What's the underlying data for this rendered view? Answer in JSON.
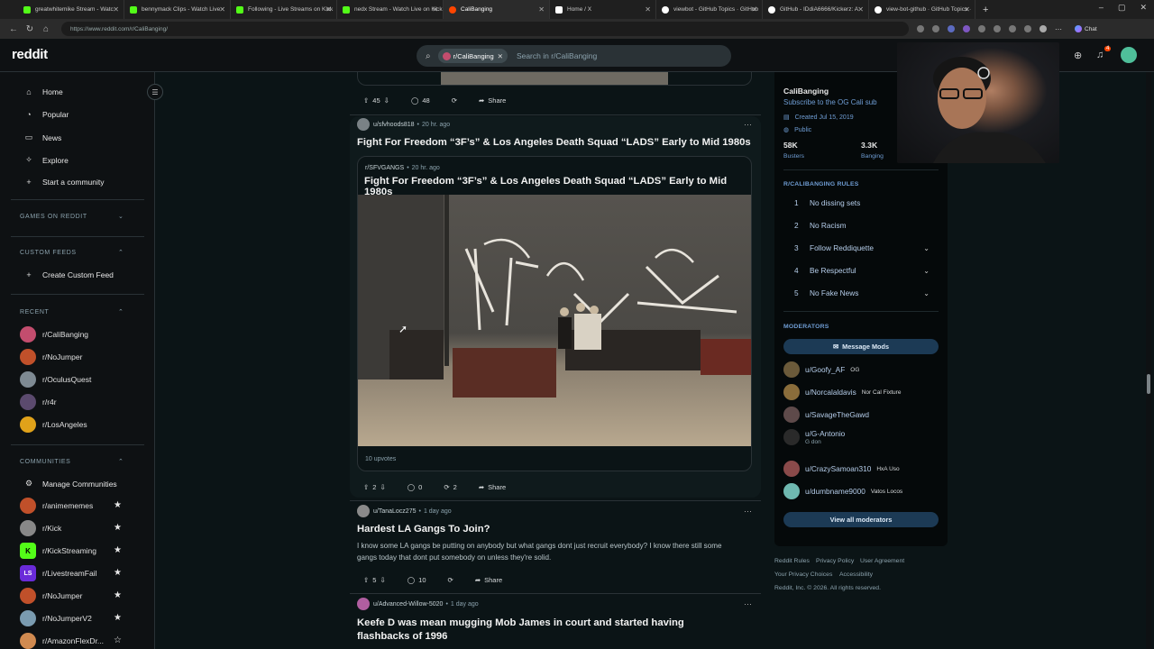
{
  "browser": {
    "tabs": [
      {
        "label": "greatwhitemike Stream - Watc",
        "color": "#53fc18"
      },
      {
        "label": "bennymack Clips - Watch Live",
        "color": "#53fc18"
      },
      {
        "label": "Following - Live Streams on Kick",
        "color": "#53fc18"
      },
      {
        "label": "nedx Stream - Watch Live on Kick",
        "color": "#53fc18"
      },
      {
        "label": "CaliBanging",
        "color": "#ff4500"
      },
      {
        "label": "Home / X",
        "color": "#ffffff"
      },
      {
        "label": "viewbot - GitHub Topics · GitHub",
        "color": "#ffffff"
      },
      {
        "label": "GitHub - IDdiA6666/Kickerz: A",
        "color": "#ffffff"
      },
      {
        "label": "view-bot-github · GitHub Topics ·",
        "color": "#ffffff"
      }
    ],
    "url": "https://www.reddit.com/r/CaliBanging/",
    "chat_label": "Chat"
  },
  "header": {
    "logo": "reddit",
    "search_chip": "r/CaliBanging",
    "search_placeholder": "Search in r/CaliBanging",
    "notif_count": "4"
  },
  "sidebar": {
    "main_items": [
      {
        "icon": "home-icon",
        "label": "Home"
      },
      {
        "icon": "popular-icon",
        "label": "Popular"
      },
      {
        "icon": "news-icon",
        "label": "News"
      },
      {
        "icon": "explore-icon",
        "label": "Explore"
      },
      {
        "icon": "plus-icon",
        "label": "Start a community"
      }
    ],
    "games_title": "GAMES ON REDDIT",
    "custom_feeds_title": "CUSTOM FEEDS",
    "create_custom_feed": "Create Custom Feed",
    "recent_title": "RECENT",
    "recent": [
      {
        "label": "r/CaliBanging",
        "color": "#c34d6e"
      },
      {
        "label": "r/NoJumper",
        "color": "#c0502a"
      },
      {
        "label": "r/OculusQuest",
        "color": "#7e8a93"
      },
      {
        "label": "r/r4r",
        "color": "#5b4a6e"
      },
      {
        "label": "r/LosAngeles",
        "color": "#e0a21a"
      }
    ],
    "communities_title": "COMMUNITIES",
    "manage_communities": "Manage Communities",
    "communities": [
      {
        "label": "r/animememes",
        "color": "#c0502a"
      },
      {
        "label": "r/Kick",
        "color": "#888888"
      },
      {
        "label": "r/KickStreaming",
        "color": "#53fc18"
      },
      {
        "label": "r/LivestreamFail",
        "color": "#6a2bd9"
      },
      {
        "label": "r/NoJumper",
        "color": "#c0502a"
      },
      {
        "label": "r/NoJumperV2",
        "color": "#7a9bb0"
      },
      {
        "label": "r/AmazonFlexDr...",
        "color": "#d08a50"
      }
    ]
  },
  "feed": {
    "post0": {
      "votes": "45",
      "comments": "48",
      "share": "Share"
    },
    "post1": {
      "user": "u/sfvhoods818",
      "time": "20 hr. ago",
      "title": "Fight For Freedom “3F’s” & Los Angeles Death Squad “LADS” Early to Mid 1980s",
      "crosspost_sub": "r/SFVGANGS",
      "crosspost_time": "20 hr. ago",
      "crosspost_title": "Fight For Freedom “3F’s” & Los Angeles Death Squad “LADS” Early to Mid 1980s",
      "crosspost_upvotes": "10 upvotes",
      "votes": "2",
      "comments": "0",
      "crossposts": "2",
      "share": "Share"
    },
    "post2": {
      "user": "u/TanaLocz275",
      "time": "1 day ago",
      "title": "Hardest LA Gangs To Join?",
      "body": "I know some LA gangs be putting on anybody but what gangs dont just recruit everybody? I know there still some gangs today that dont put somebody on unless they're solid.",
      "votes": "5",
      "comments": "10",
      "share": "Share"
    },
    "post3": {
      "user": "u/Advanced-Willow-5020",
      "time": "1 day ago",
      "title": "Keefe D was mean mugging Mob James in court and started having flashbacks of 1996"
    }
  },
  "community": {
    "name": "CaliBanging",
    "tagline": "Subscribe to the OG Cali sub",
    "created": "Created Jul 15, 2019",
    "visibility": "Public",
    "members": "58K",
    "members_label": "Busters",
    "online": "3.3K",
    "online_label": "Banging",
    "rules_title": "R/CALIBANGING RULES",
    "rules": [
      {
        "n": "1",
        "text": "No dissing sets",
        "expand": false
      },
      {
        "n": "2",
        "text": "No Racism",
        "expand": false
      },
      {
        "n": "3",
        "text": "Follow Reddiquette",
        "expand": true
      },
      {
        "n": "4",
        "text": "Be Respectful",
        "expand": true
      },
      {
        "n": "5",
        "text": "No Fake News",
        "expand": true
      }
    ],
    "moderators_title": "MODERATORS",
    "message_mods": "Message Mods",
    "mods": [
      {
        "name": "u/Goofy_AF",
        "flair": "OG",
        "sub": "",
        "color": "#6b5a3a"
      },
      {
        "name": "u/Norcalaldavis",
        "flair": "Nor Cal Fixture",
        "sub": "",
        "color": "#8a6d3b"
      },
      {
        "name": "u/SavageTheGawd",
        "flair": "",
        "sub": "",
        "color": "#5e4a4a"
      },
      {
        "name": "u/G-Antonio",
        "flair": "",
        "sub": "G don",
        "color": "#2a2a2a"
      },
      {
        "name": "u/CrazySamoan310",
        "flair": "HxA Uso",
        "sub": "",
        "color": "#8a4a4a"
      },
      {
        "name": "u/dumbname9000",
        "flair": "Vatos Locos",
        "sub": "",
        "color": "#6fb8b0"
      }
    ],
    "view_all_mods": "View all moderators"
  },
  "footer": {
    "links_row1": [
      "Reddit Rules",
      "Privacy Policy",
      "User Agreement"
    ],
    "links_row2": [
      "Your Privacy Choices",
      "Accessibility"
    ],
    "copyright": "Reddit, Inc. © 2026. All rights reserved."
  }
}
